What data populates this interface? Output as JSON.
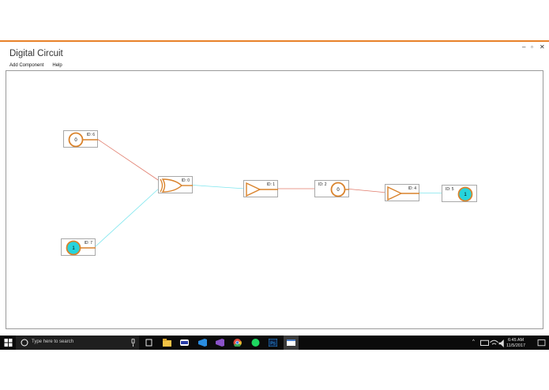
{
  "window": {
    "title": "Digital Circuit",
    "controls": {
      "minimize": "–",
      "restore": "▫",
      "close": "✕"
    }
  },
  "menu": {
    "items": [
      {
        "label": "Add Component"
      },
      {
        "label": "Help"
      }
    ]
  },
  "components": [
    {
      "id_label": "ID: 6",
      "type": "input",
      "value": "0"
    },
    {
      "id_label": "ID: 0",
      "type": "xor-gate"
    },
    {
      "id_label": "ID: 7",
      "type": "input",
      "value": "1"
    },
    {
      "id_label": "ID: 1",
      "type": "buffer"
    },
    {
      "id_label": "ID: 2",
      "type": "node",
      "value": "0"
    },
    {
      "id_label": "ID: 4",
      "type": "buffer"
    },
    {
      "id_label": "ID: 5",
      "type": "output",
      "value": "1"
    }
  ],
  "colors": {
    "accent": "#e8822a",
    "wire_low": "#e07a6a",
    "wire_high": "#7ee6ee",
    "active_fill": "#26d4dc",
    "gate_stroke": "#d9822b"
  },
  "taskbar": {
    "search_placeholder": "Type here to search",
    "icons": [
      "windows-icon",
      "search-icon",
      "mic-icon",
      "task-view-icon",
      "file-explorer-icon",
      "media-icon",
      "visual-studio-code-icon",
      "visual-studio-icon",
      "chrome-icon",
      "spotify-icon",
      "photoshop-icon",
      "app-window-icon"
    ],
    "time": "6:45 AM",
    "date": "11/5/2017"
  }
}
